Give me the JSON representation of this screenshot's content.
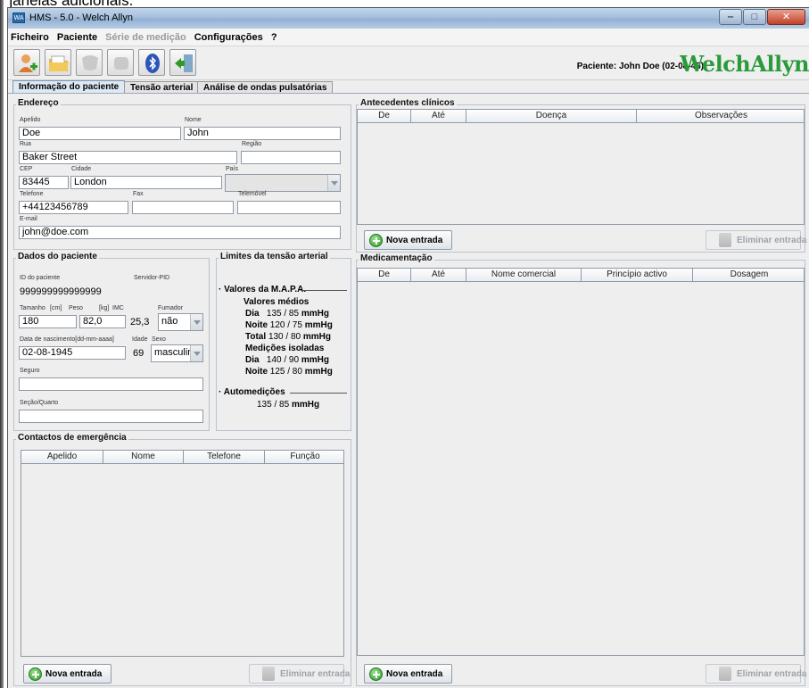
{
  "cut_text": "r janelas adicionais.",
  "window": {
    "title": "HMS - 5.0 - Welch Allyn",
    "app_icon_text": "WA"
  },
  "menu": {
    "items": [
      {
        "label": "Ficheiro",
        "enabled": true
      },
      {
        "label": "Paciente",
        "enabled": true
      },
      {
        "label": "Série de medição",
        "enabled": false
      },
      {
        "label": "Configurações",
        "enabled": true
      },
      {
        "label": "?",
        "enabled": true
      }
    ]
  },
  "toolbar": {
    "patient_label": "Paciente: John Doe (02-08-45)",
    "brand": "WelchAllyn"
  },
  "tabs": [
    {
      "label": "Informação do paciente",
      "active": true
    },
    {
      "label": "Tensão arterial",
      "active": false
    },
    {
      "label": "Análise de ondas pulsatórias",
      "active": false
    }
  ],
  "address": {
    "title": "Endereço",
    "surname_label": "Apelido",
    "surname": "Doe",
    "name_label": "Nome",
    "name": "John",
    "street_label": "Rua",
    "street": "Baker Street",
    "region_label": "Região",
    "region": "",
    "zip_label": "CEP",
    "zip": "83445",
    "city_label": "Cidade",
    "city": "London",
    "country_label": "País",
    "country": "",
    "phone_label": "Telefone",
    "phone": "+44123456789",
    "fax_label": "Fax",
    "fax": "",
    "mobile_label": "Telemóvel",
    "mobile": "",
    "email_label": "E-mail",
    "email": "john@doe.com"
  },
  "patient": {
    "title": "Dados do paciente",
    "id_label": "ID do paciente",
    "id": "999999999999999",
    "server_label": "Servidor-PID",
    "height_label": "Tamanho",
    "height_unit": "[cm]",
    "height": "180",
    "weight_label": "Peso",
    "weight_unit": "[kg]",
    "weight": "82,0",
    "bmi_label": "IMC",
    "bmi": "25,3",
    "smoker_label": "Fumador",
    "smoker": "não",
    "dob_label": "Data de nascimento[dd-mm-aaaa]",
    "dob": "02-08-1945",
    "age_label": "Idade",
    "age": "69",
    "sex_label": "Sexo",
    "sex": "masculino",
    "insurance_label": "Seguro",
    "insurance": "",
    "ward_label": "Seção/Quarto",
    "ward": ""
  },
  "bp_limits": {
    "title": "Limites da tensão arterial",
    "mapa_label": "Valores da M.A.P.A.",
    "avg_label": "Valores médios",
    "day_label": "Dia",
    "day_avg": "135 / 85",
    "night_label": "Noite",
    "night_avg": "120 / 75",
    "total_label": "Total",
    "total_avg": "130 / 80",
    "isolated_label": "Medições isoladas",
    "day_iso": "140 / 90",
    "night_iso": "125 / 80",
    "unit": "mmHg",
    "self_label": "Automedições",
    "self_val": "135 / 85"
  },
  "emergency": {
    "title": "Contactos de emergência",
    "columns": [
      "Apelido",
      "Nome",
      "Telefone",
      "Função"
    ],
    "new_label": "Nova entrada",
    "delete_label": "Eliminar entrada"
  },
  "history": {
    "title": "Antecedentes clínicos",
    "columns": [
      "De",
      "Até",
      "Doença",
      "Observações"
    ],
    "new_label": "Nova entrada",
    "delete_label": "Eliminar entrada"
  },
  "medication": {
    "title": "Medicamentação",
    "columns": [
      "De",
      "Até",
      "Nome comercial",
      "Princípio activo",
      "Dosagem"
    ],
    "new_label": "Nova entrada",
    "delete_label": "Eliminar entrada"
  }
}
